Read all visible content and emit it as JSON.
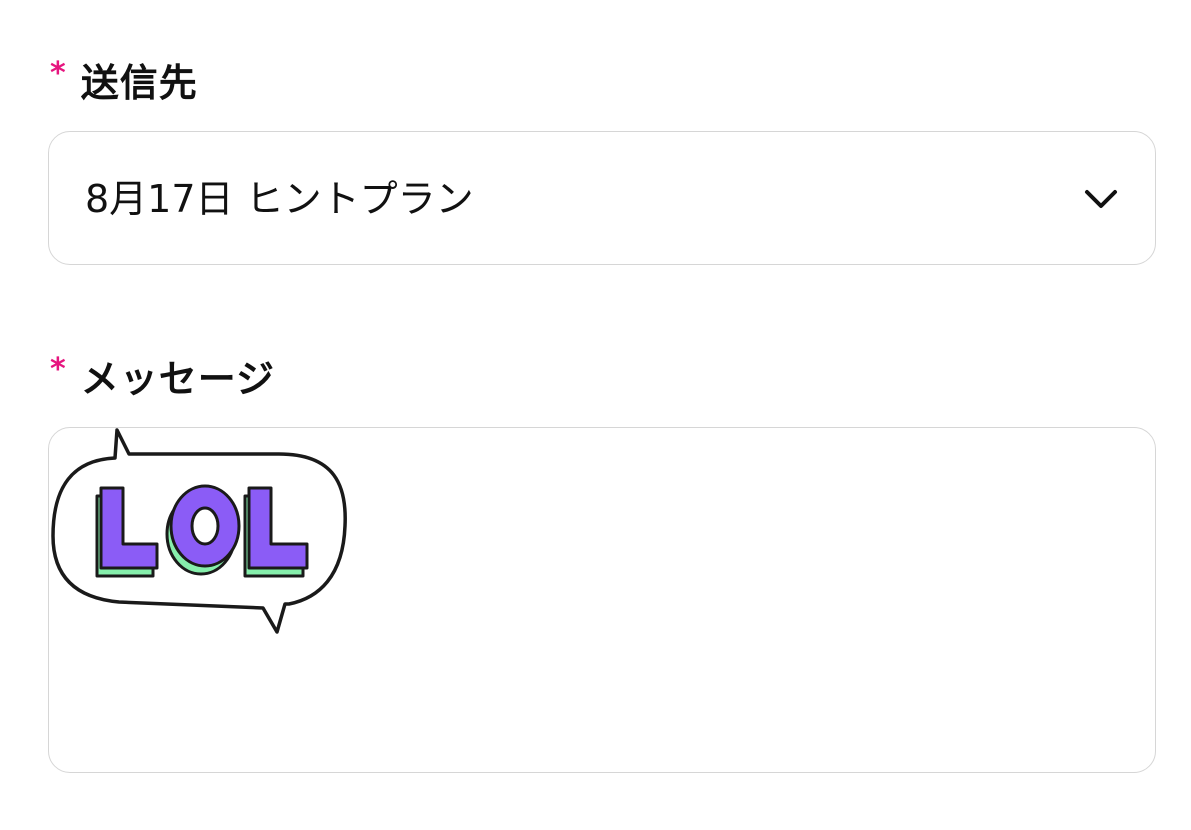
{
  "recipient": {
    "required_mark": "*",
    "label": "送信先",
    "selected_value": "8月17日 ヒントプラン",
    "chevron_icon": "chevron-down-icon"
  },
  "message": {
    "required_mark": "*",
    "label": "メッセージ",
    "sticker": {
      "icon": "lol-speech-bubble-sticker",
      "text": "LOL",
      "colors": {
        "letter_face": "#8b5cf6",
        "letter_side": "#86efac",
        "outline": "#1a1a1a"
      }
    }
  },
  "colors": {
    "required_mark": "#e6157f",
    "border": "#d6d6d6",
    "text": "#111111"
  }
}
